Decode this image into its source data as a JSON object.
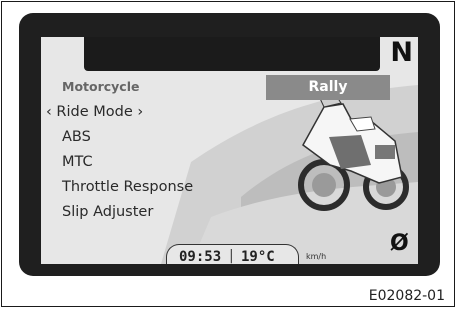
{
  "display": {
    "gear": "N",
    "category_label": "Motorcycle",
    "selected_value": "Rally",
    "menu": [
      "‹ Ride Mode ›",
      "ABS",
      "MTC",
      "Throttle Response",
      "Slip Adjuster"
    ],
    "time": "09:53",
    "separator": "|",
    "temperature": "19°C",
    "speed_unit": "km/h",
    "zero_symbol": "Ø"
  },
  "caption": "E02082-01",
  "icons": [
    "motorcycle-illustration",
    "zero-icon"
  ]
}
